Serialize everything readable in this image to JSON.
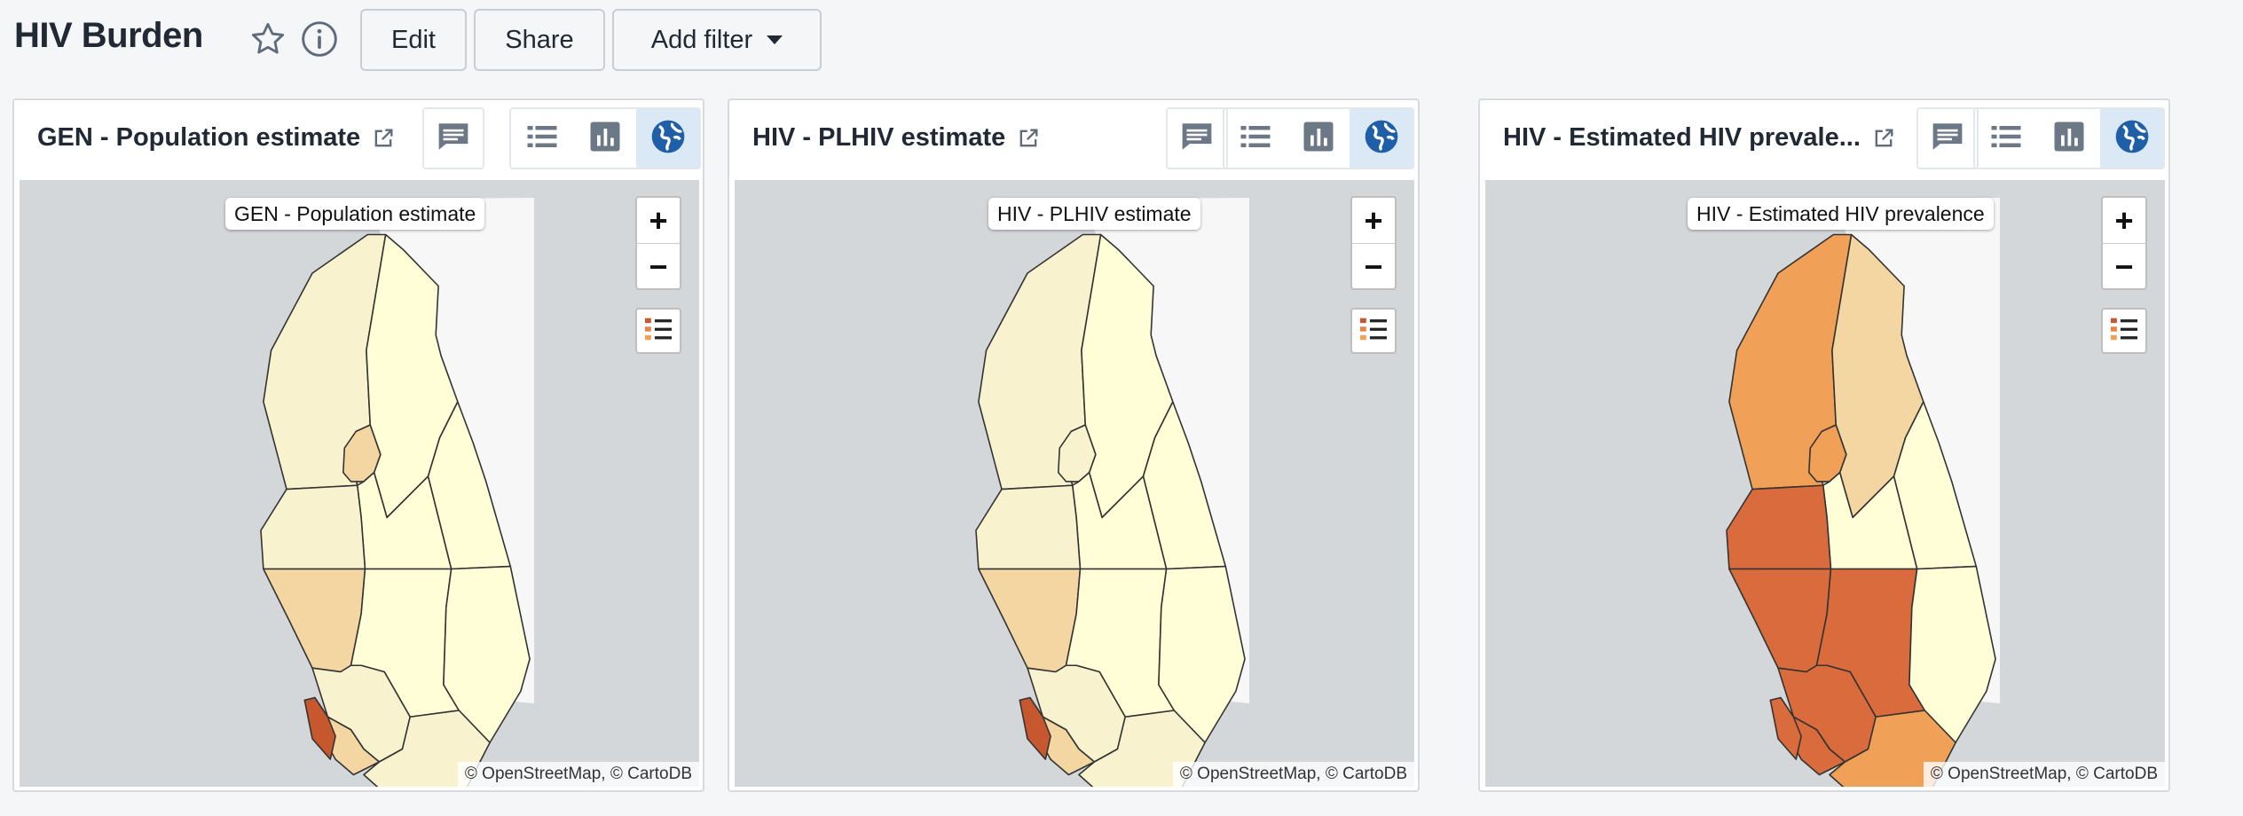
{
  "header": {
    "title": "HIV Burden",
    "edit_label": "Edit",
    "share_label": "Share",
    "add_filter_label": "Add filter"
  },
  "panels": [
    {
      "title": "GEN - Population estimate",
      "map_label": "GEN - Population estimate",
      "attribution": "© OpenStreetMap, © CartoDB",
      "active_view": "map"
    },
    {
      "title": "HIV - PLHIV estimate",
      "map_label": "HIV - PLHIV estimate",
      "attribution": "© OpenStreetMap, © CartoDB",
      "active_view": "map"
    },
    {
      "title": "HIV - Estimated HIV prevale...",
      "map_label": "HIV - Estimated HIV prevalence",
      "attribution": "© OpenStreetMap, © CartoDB",
      "active_view": "map"
    }
  ],
  "map_controls": {
    "zoom_in": "+",
    "zoom_out": "−"
  },
  "icons": {
    "favorite": "star-icon",
    "info": "info-icon",
    "dropdown": "caret-down-icon",
    "external": "external-link-icon",
    "comment": "comment-icon",
    "table": "table-icon",
    "chart": "bar-chart-icon",
    "map": "globe-icon",
    "legend": "legend-icon"
  },
  "colors": {
    "background": "#f4f6f8",
    "active_view": "#dbe9f7",
    "active_icon": "#1f5fa8",
    "scale": [
      "#fffed7",
      "#f9f2cf",
      "#f4d6a2",
      "#f1a157",
      "#d96b3c",
      "#c6572f"
    ]
  }
}
